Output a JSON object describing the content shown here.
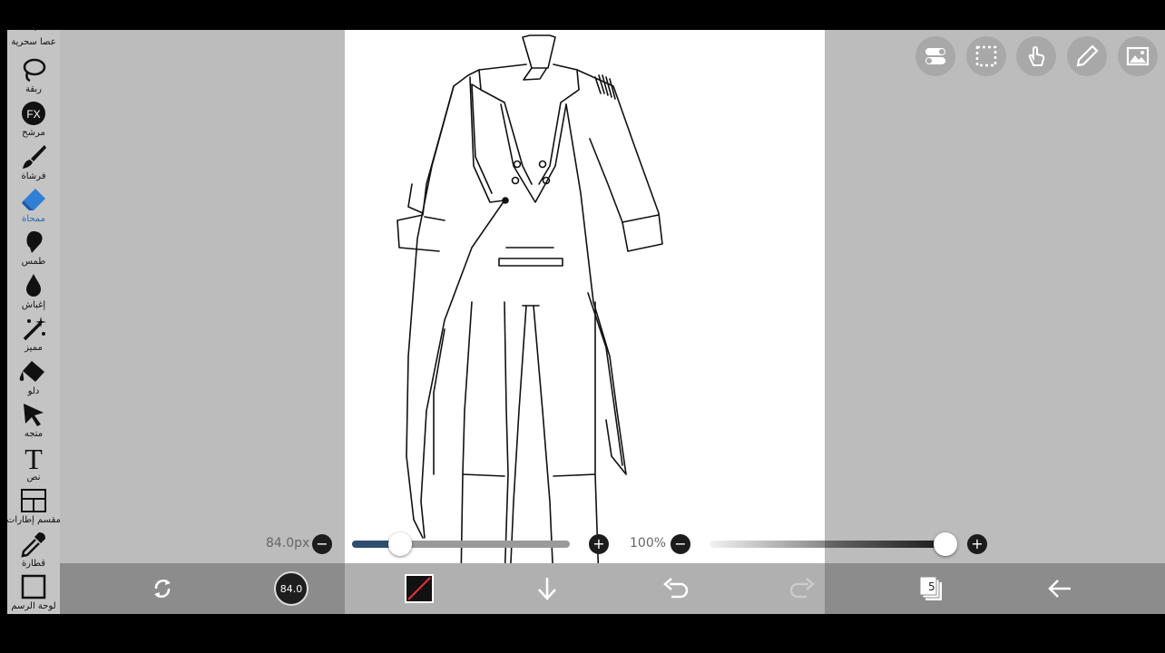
{
  "toolbar": {
    "tools": [
      {
        "label": "عصا سحرية",
        "icon": "magic-wand-icon"
      },
      {
        "label": "ربقة",
        "icon": "lasso-icon"
      },
      {
        "label": "مرشح",
        "icon": "fx-filter-icon"
      },
      {
        "label": "فرشاة",
        "icon": "brush-icon"
      },
      {
        "label": "ممحاة",
        "icon": "eraser-icon",
        "active": true
      },
      {
        "label": "طمس",
        "icon": "smudge-icon"
      },
      {
        "label": "إغباش",
        "icon": "blur-icon"
      },
      {
        "label": "مميز",
        "icon": "special-icon"
      },
      {
        "label": "دلو",
        "icon": "bucket-icon"
      },
      {
        "label": "متجه",
        "icon": "move-icon"
      },
      {
        "label": "نص",
        "icon": "text-icon"
      },
      {
        "label": "مقسم إطارات",
        "icon": "frame-divider-icon"
      },
      {
        "label": "قطارة",
        "icon": "eyedropper-icon"
      },
      {
        "label": "لوحة الرسم",
        "icon": "canvas-icon"
      }
    ]
  },
  "top_buttons": [
    "toggle-icon",
    "selection-icon",
    "touch-icon",
    "pen-icon",
    "image-icon"
  ],
  "brush_size": {
    "label": "84.0px",
    "value_fraction": 0.22
  },
  "opacity": {
    "label": "100%",
    "value_fraction": 1.0
  },
  "bottom_bar": {
    "brush_preview_label": "84.0",
    "layers_count": "5"
  },
  "colors": {
    "workspace": "#bcbcbc",
    "toolbar": "#c4c4c4",
    "bottom_bar": "#8c8c8c",
    "slider_fill": "#2f4f70",
    "active_tool": "#2b6cb0"
  }
}
